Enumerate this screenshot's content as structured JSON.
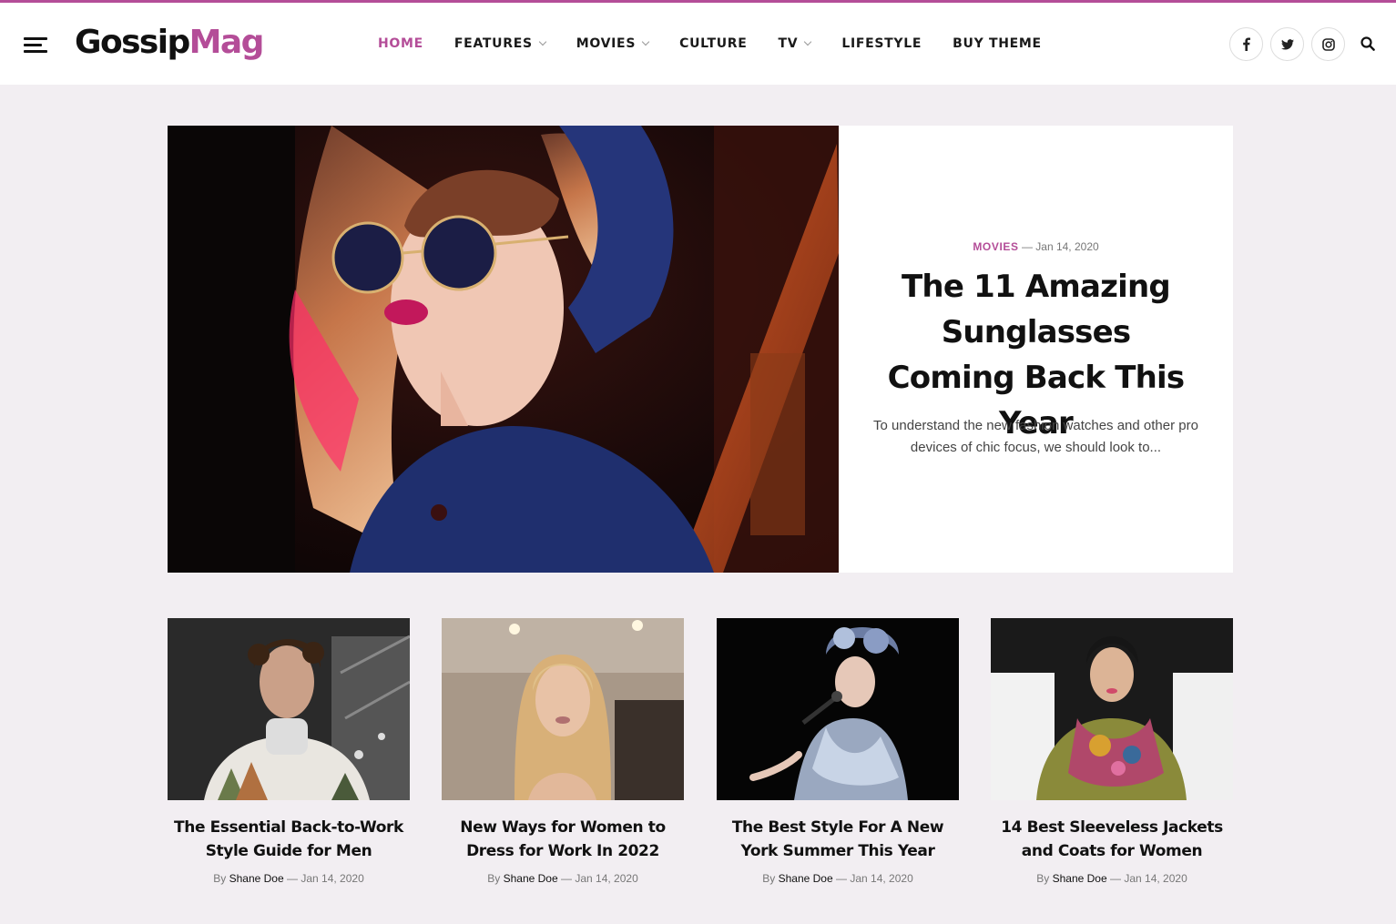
{
  "brand": {
    "logo_part1": "Gossip",
    "logo_part2": "Mag",
    "accent_color": "#b44d98"
  },
  "header": {
    "menu_icon": "hamburger-icon",
    "nav": [
      {
        "label": "HOME",
        "active": true,
        "dropdown": false
      },
      {
        "label": "FEATURES",
        "active": false,
        "dropdown": true
      },
      {
        "label": "MOVIES",
        "active": false,
        "dropdown": true
      },
      {
        "label": "CULTURE",
        "active": false,
        "dropdown": false
      },
      {
        "label": "TV",
        "active": false,
        "dropdown": true
      },
      {
        "label": "LIFESTYLE",
        "active": false,
        "dropdown": false
      },
      {
        "label": "BUY THEME",
        "active": false,
        "dropdown": false
      }
    ],
    "social_icons": [
      "facebook-icon",
      "twitter-icon",
      "instagram-icon"
    ],
    "search_icon": "search-icon"
  },
  "featured": {
    "category": "MOVIES",
    "separator": "—",
    "date": "Jan 14, 2020",
    "title": "The 11 Amazing Sunglasses Coming Back This Year",
    "excerpt": "To understand the new fashion watches and other pro devices of chic focus, we should look to..."
  },
  "cards": [
    {
      "title": "The Essential Back-to-Work Style Guide for Men",
      "by": "By",
      "author": "Shane Doe",
      "separator": "—",
      "date": "Jan 14, 2020"
    },
    {
      "title": "New Ways for Women to Dress for Work In 2022",
      "by": "By",
      "author": "Shane Doe",
      "separator": "—",
      "date": "Jan 14, 2020"
    },
    {
      "title": "The Best Style For A New York Summer This Year",
      "by": "By",
      "author": "Shane Doe",
      "separator": "—",
      "date": "Jan 14, 2020"
    },
    {
      "title": "14 Best Sleeveless Jackets and Coats for Women",
      "by": "By",
      "author": "Shane Doe",
      "separator": "—",
      "date": "Jan 14, 2020"
    }
  ]
}
